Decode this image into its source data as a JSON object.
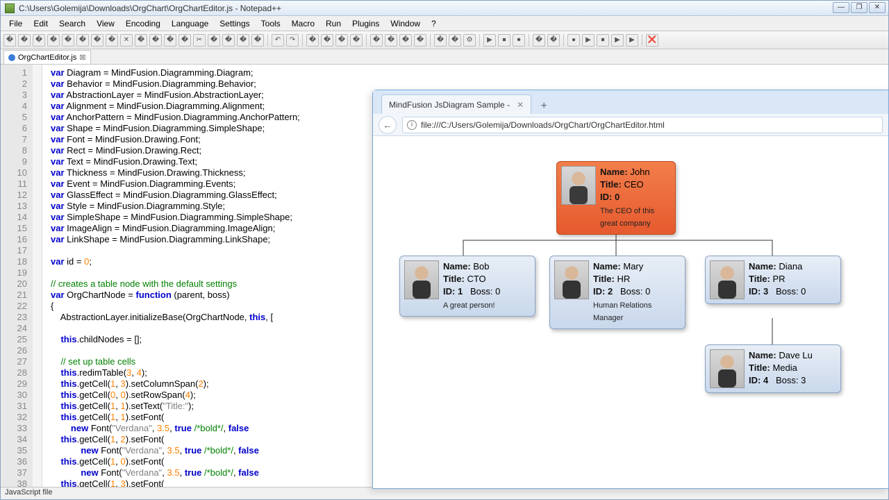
{
  "npp": {
    "title": "C:\\Users\\Golemija\\Downloads\\OrgChart\\OrgChartEditor.js - Notepad++",
    "menu": [
      "File",
      "Edit",
      "Search",
      "View",
      "Encoding",
      "Language",
      "Settings",
      "Tools",
      "Macro",
      "Run",
      "Plugins",
      "Window",
      "?"
    ],
    "tab": "OrgChartEditor.js",
    "status": "JavaScript file",
    "code": [
      "var Diagram = MindFusion.Diagramming.Diagram;",
      "var Behavior = MindFusion.Diagramming.Behavior;",
      "var AbstractionLayer = MindFusion.AbstractionLayer;",
      "var Alignment = MindFusion.Diagramming.Alignment;",
      "var AnchorPattern = MindFusion.Diagramming.AnchorPattern;",
      "var Shape = MindFusion.Diagramming.SimpleShape;",
      "var Font = MindFusion.Drawing.Font;",
      "var Rect = MindFusion.Drawing.Rect;",
      "var Text = MindFusion.Drawing.Text;",
      "var Thickness = MindFusion.Drawing.Thickness;",
      "var Event = MindFusion.Diagramming.Events;",
      "var GlassEffect = MindFusion.Diagramming.GlassEffect;",
      "var Style = MindFusion.Diagramming.Style;",
      "var SimpleShape = MindFusion.Diagramming.SimpleShape;",
      "var ImageAlign = MindFusion.Diagramming.ImageAlign;",
      "var LinkShape = MindFusion.Diagramming.LinkShape;",
      "",
      "var id = 0;",
      "",
      "// creates a table node with the default settings",
      "var OrgChartNode = function (parent, boss)",
      "{",
      "    AbstractionLayer.initializeBase(OrgChartNode, this, [",
      "",
      "    this.childNodes = [];",
      "",
      "    // set up table cells",
      "    this.redimTable(3, 4);",
      "    this.getCell(1, 3).setColumnSpan(2);",
      "    this.getCell(0, 0).setRowSpan(4);",
      "    this.getCell(1, 1).setText(\"Title:\");",
      "    this.getCell(1, 1).setFont(",
      "        new Font(\"Verdana\", 3.5, true /*bold*/, false",
      "    this.getCell(1, 2).setFont(",
      "            new Font(\"Verdana\", 3.5, true /*bold*/, false",
      "    this.getCell(1, 0).setFont(",
      "            new Font(\"Verdana\", 3.5, true /*bold*/, false",
      "    this.getCell(1, 3).setFont("
    ]
  },
  "browser": {
    "tab": "MindFusion JsDiagram Sample -",
    "url": "file:///C:/Users/Golemija/Downloads/OrgChart/OrgChartEditor.html"
  },
  "labels": {
    "name": "Name:",
    "title": "Title:",
    "id": "ID:",
    "boss": "Boss:"
  },
  "org": {
    "root": {
      "name": "John",
      "title": "CEO",
      "id": "0",
      "desc": "The CEO of this great company"
    },
    "children": [
      {
        "name": "Bob",
        "title": "CTO",
        "id": "1",
        "boss": "0",
        "desc": "A great person!"
      },
      {
        "name": "Mary",
        "title": "HR",
        "id": "2",
        "boss": "0",
        "desc": "Human Relations Manager"
      },
      {
        "name": "Diana",
        "title": "PR",
        "id": "3",
        "boss": "0",
        "desc": ""
      },
      {
        "name": "Dave Lu",
        "title": "Media",
        "id": "4",
        "boss": "3",
        "desc": ""
      }
    ]
  }
}
